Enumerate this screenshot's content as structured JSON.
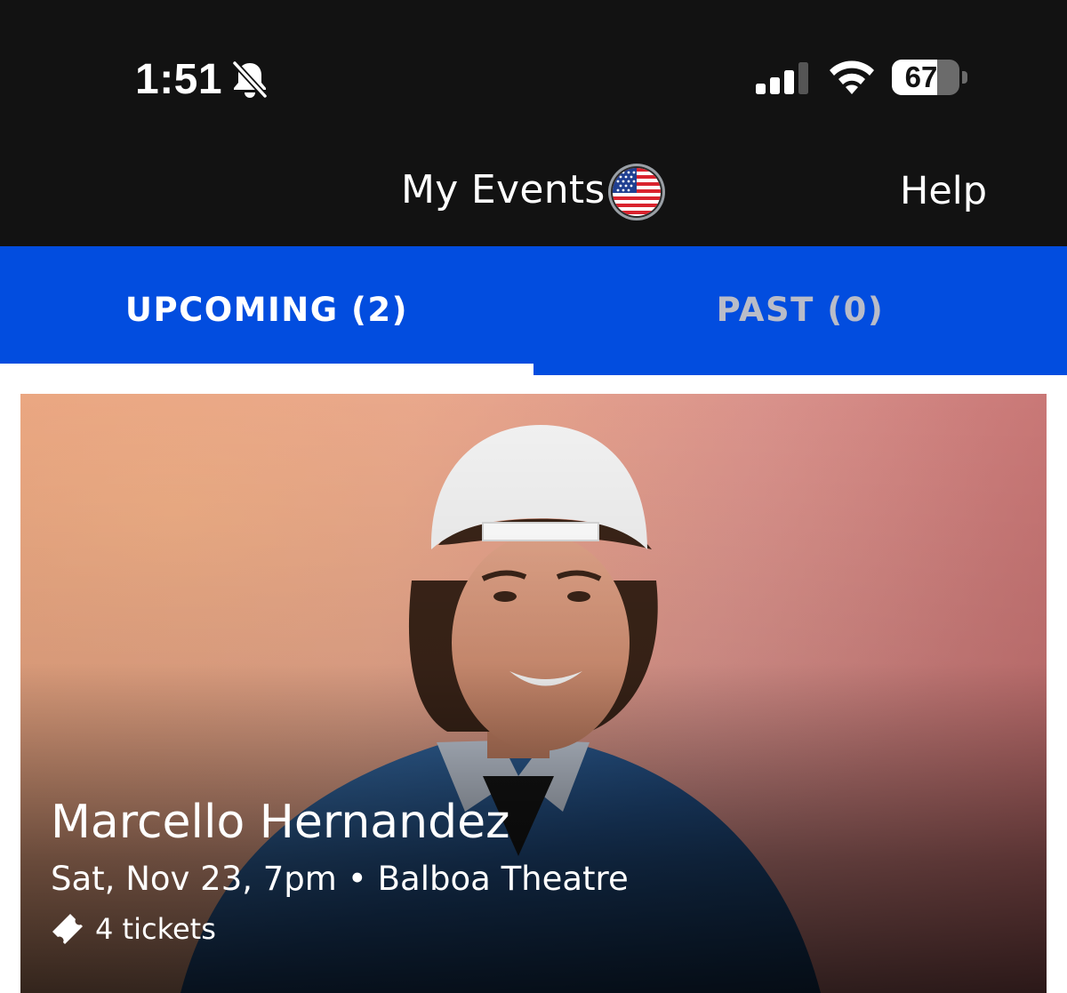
{
  "status_bar": {
    "time": "1:51",
    "battery_percent": "67",
    "battery_level": 0.67,
    "icons": [
      "bell-slash-icon",
      "cellular-signal-icon",
      "wifi-icon",
      "battery-icon"
    ]
  },
  "header": {
    "title": "My Events",
    "region_icon": "us-flag-icon",
    "help_label": "Help"
  },
  "tabs": [
    {
      "label": "UPCOMING (2)",
      "selected": true
    },
    {
      "label": "PAST (0)",
      "selected": false
    }
  ],
  "events": [
    {
      "name": "Marcello Hernandez",
      "date_time": "Sat, Nov 23, 7pm",
      "separator": "•",
      "venue": "Balboa Theatre",
      "tickets_label": "4 tickets",
      "tickets_icon": "ticket-icon"
    }
  ],
  "colors": {
    "header_bg": "#121212",
    "tab_bg": "#024ddf",
    "tab_active_text": "#ffffff",
    "tab_inactive_text": "#b9bcc8"
  }
}
